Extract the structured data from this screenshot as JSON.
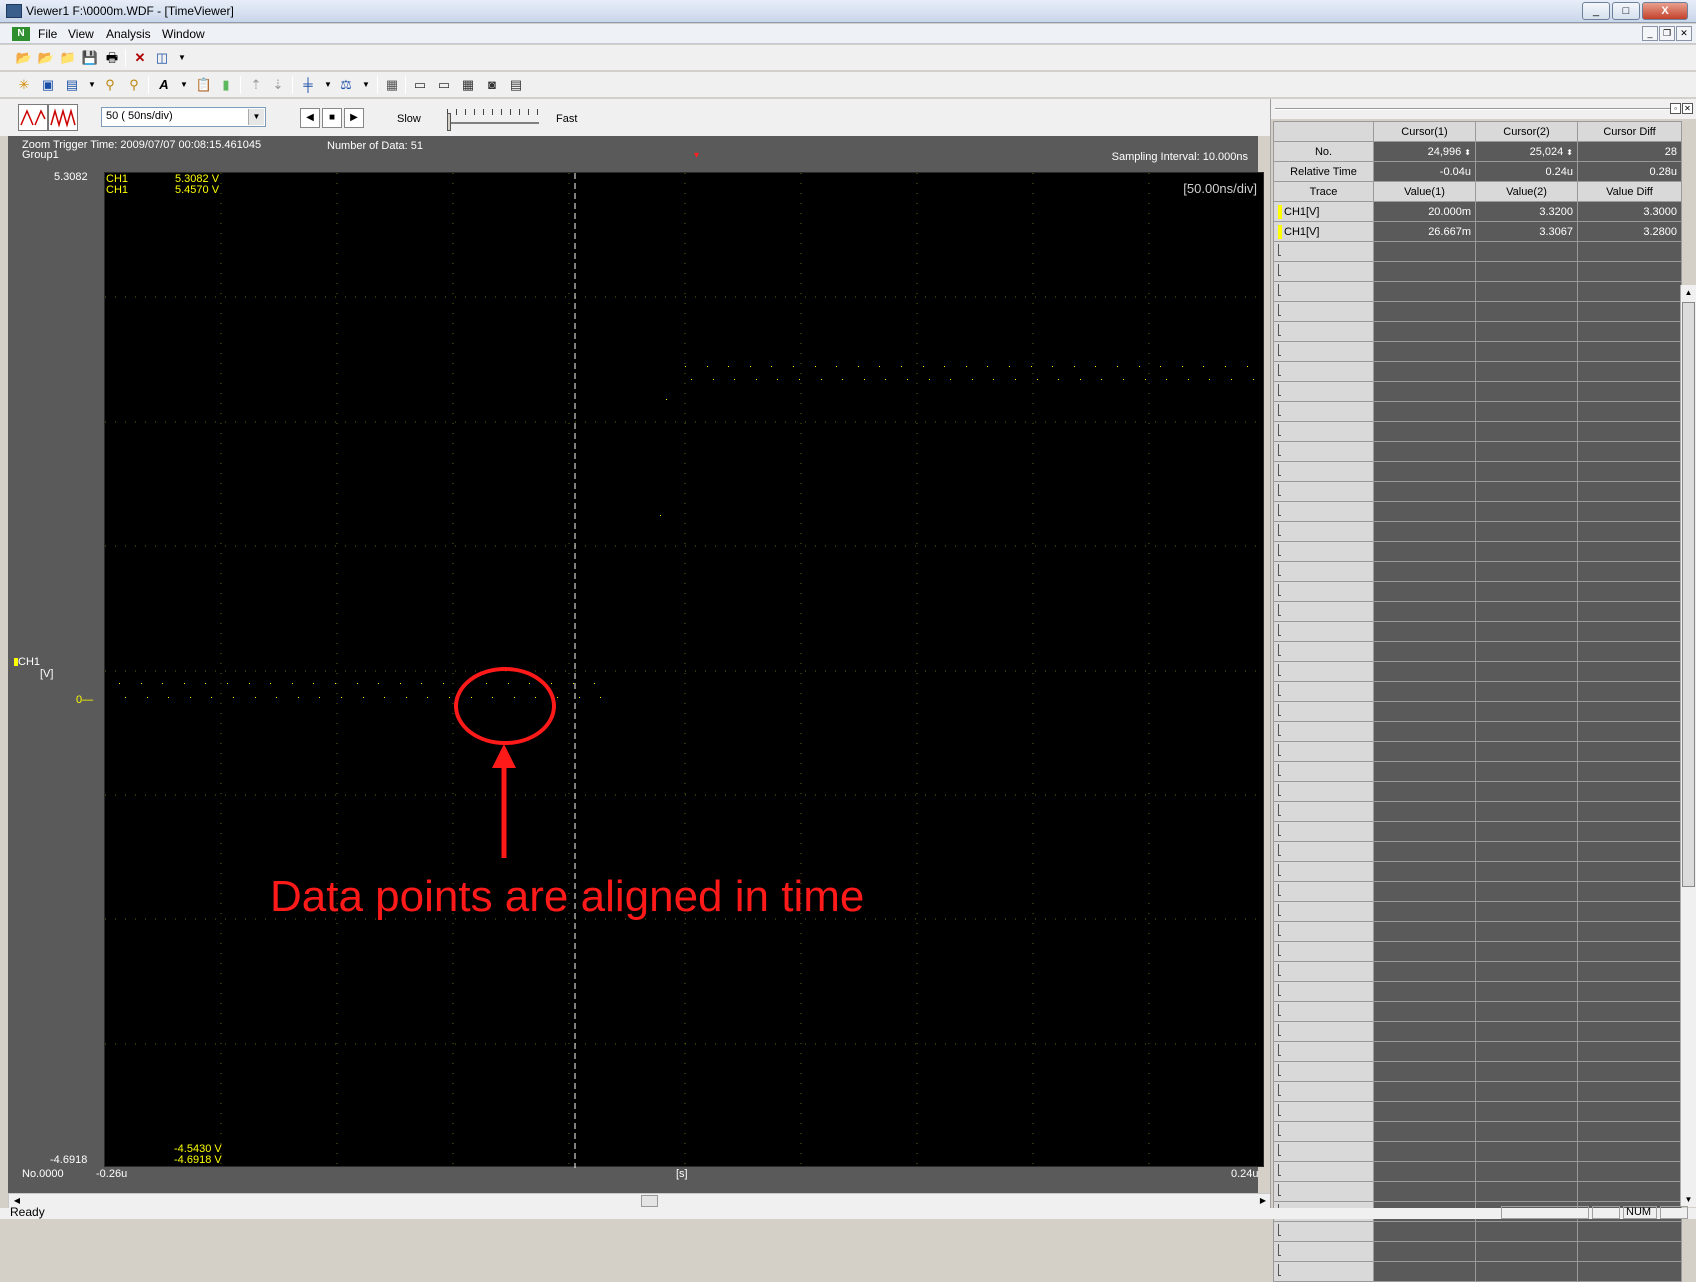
{
  "window": {
    "title": "Viewer1 F:\\0000m.WDF - [TimeViewer]",
    "minimize": "_",
    "maximize": "□",
    "close": "X"
  },
  "menu": {
    "items": [
      "File",
      "View",
      "Analysis",
      "Window"
    ]
  },
  "viewer": {
    "zoom_value": "50   ( 50ns/div)",
    "speed_slow": "Slow",
    "speed_fast": "Fast",
    "header_left_line1": "Zoom Trigger Time: 2009/07/07 00:08:15.461045",
    "header_left_line2": "Group1",
    "number_of_data": "Number of Data: 51",
    "sampling_interval": "Sampling Interval:  10.000ns",
    "div_label": "[50.00ns/div]",
    "y_top": "5.3082",
    "y_bottom": "-4.6918",
    "ch_top_1": "CH1",
    "ch_top_2": "CH1",
    "ch_top_v1": "5.3082 V",
    "ch_top_v2": "5.4570 V",
    "ch_bottom_v1": "-4.5430 V",
    "ch_bottom_v2": "-4.6918 V",
    "channel_label": "CH1",
    "channel_unit": "[V]",
    "zero_label": "0",
    "x_no": "No.0000",
    "x_start": "-0.26u",
    "x_unit": "[s]",
    "x_end": "0.24u"
  },
  "annotation": {
    "text": "Data points are aligned in time",
    "color": "#ff1a1a"
  },
  "cursor_table": {
    "headers": [
      "",
      "Cursor(1)",
      "Cursor(2)",
      "Cursor Diff"
    ],
    "rows": [
      {
        "label": "No.",
        "c1": "24,996",
        "c2": "25,024",
        "diff": "28"
      },
      {
        "label": "Relative Time",
        "c1": "-0.04u",
        "c2": "0.24u",
        "diff": "0.28u"
      }
    ],
    "trace_headers": [
      "Trace",
      "Value(1)",
      "Value(2)",
      "Value Diff"
    ],
    "traces": [
      {
        "name": "CH1[V]",
        "v1": "20.000m",
        "v2": "3.3200",
        "diff": "3.3000"
      },
      {
        "name": "CH1[V]",
        "v1": "26.667m",
        "v2": "3.3067",
        "diff": "3.2800"
      }
    ]
  },
  "status": {
    "ready": "Ready",
    "num": "NUM"
  },
  "colors": {
    "trace": "#ffff00",
    "grid": "#b8b800",
    "plot_bg": "#000000",
    "panel_bg": "#5a5a5a"
  }
}
